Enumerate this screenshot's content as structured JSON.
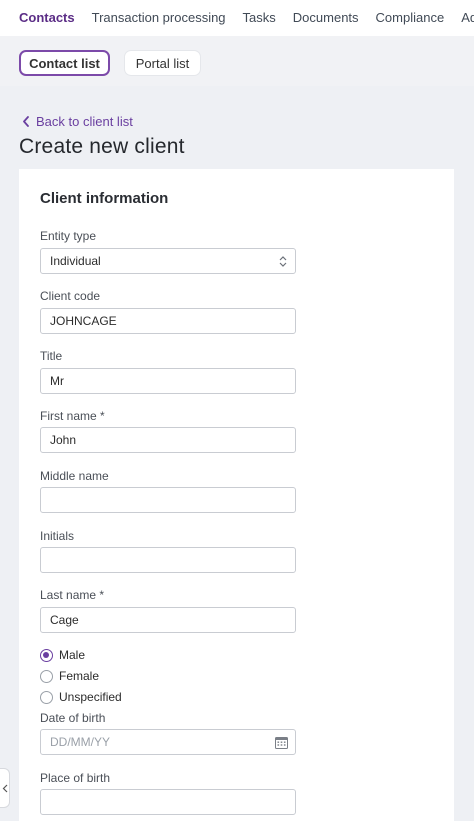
{
  "topnav": {
    "items": [
      "Contacts",
      "Transaction processing",
      "Tasks",
      "Documents",
      "Compliance",
      "Advisory"
    ],
    "active_index": 0
  },
  "subnav": {
    "tabs": [
      "Contact list",
      "Portal list"
    ],
    "active_index": 0
  },
  "back_link": "Back to client list",
  "page_title": "Create new client",
  "card": {
    "title": "Client information",
    "entity_type": {
      "label": "Entity type",
      "value": "Individual"
    },
    "client_code": {
      "label": "Client code",
      "value": "JOHNCAGE"
    },
    "title_field": {
      "label": "Title",
      "value": "Mr"
    },
    "first_name": {
      "label": "First name *",
      "value": "John"
    },
    "middle_name": {
      "label": "Middle name",
      "value": ""
    },
    "initials": {
      "label": "Initials",
      "value": ""
    },
    "last_name": {
      "label": "Last name *",
      "value": "Cage"
    },
    "gender": {
      "options": [
        "Male",
        "Female",
        "Unspecified"
      ],
      "selected": "Male"
    },
    "date_of_birth": {
      "label": "Date of birth",
      "placeholder": "DD/MM/YY",
      "value": ""
    },
    "place_of_birth": {
      "label": "Place of birth",
      "value": ""
    }
  },
  "colors": {
    "accent": "#6a3fa0",
    "page_bg": "#eef0f4",
    "card_bg": "#ffffff"
  },
  "icons": {
    "back": "chevron-left-icon",
    "select": "select-arrows-icon",
    "calendar": "calendar-icon",
    "collapse": "collapse-sidebar-icon"
  }
}
